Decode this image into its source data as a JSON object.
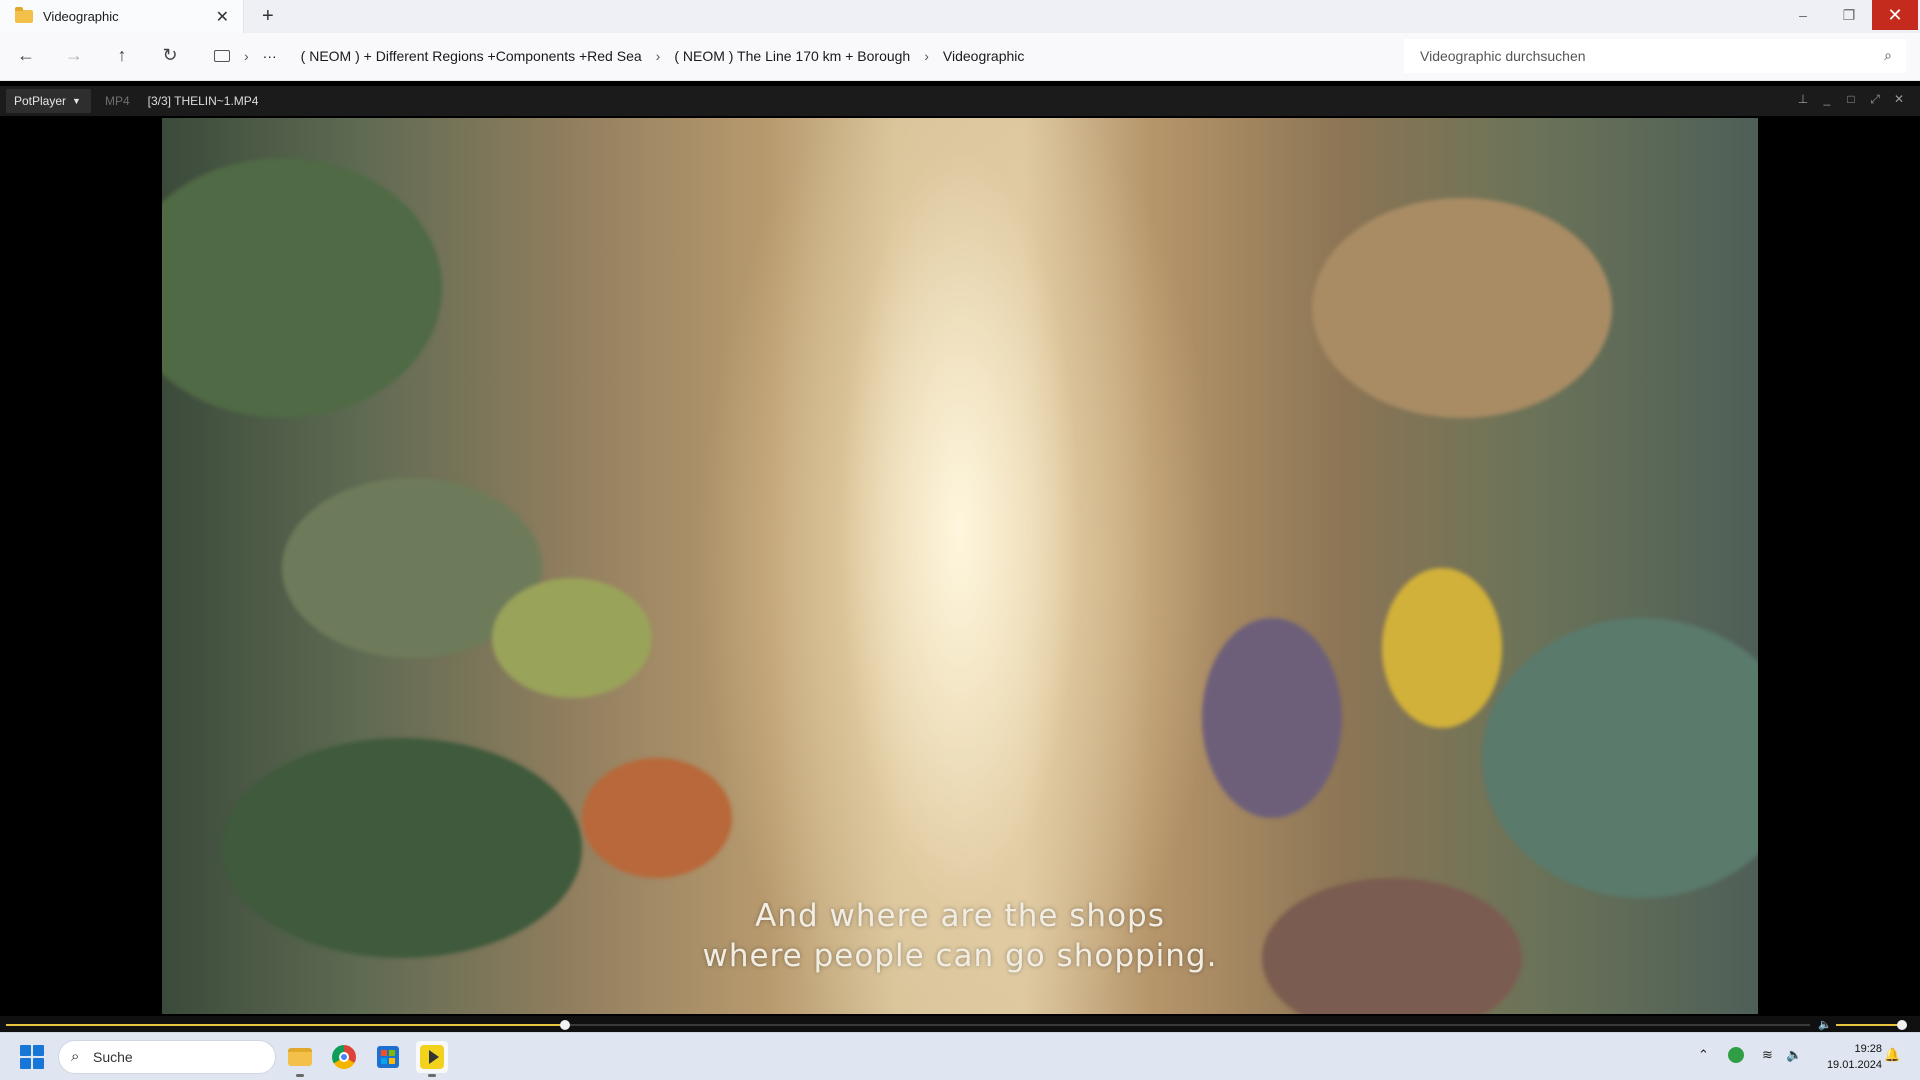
{
  "explorer": {
    "tab_title": "Videographic",
    "new_tab": "+",
    "window_controls": {
      "minimize": "–",
      "restore": "❐",
      "close": "✕"
    },
    "nav": {
      "back": "←",
      "forward": "→",
      "up": "↑",
      "refresh": "↻"
    },
    "breadcrumb": {
      "more": "···",
      "items": [
        "( NEOM ) + Different Regions +Components +Red Sea",
        "( NEOM ) The Line 170 km + Borough",
        "Videographic"
      ]
    },
    "search_placeholder": "Videographic durchsuchen"
  },
  "player": {
    "app_button": "PotPlayer",
    "format": "MP4",
    "file_title": "[3/3] THELIN~1.MP4",
    "subtitle_line1": "And where are the shops",
    "subtitle_line2": "where people can go shopping.",
    "seek_progress": 0.31,
    "volume_level": 1.0,
    "accent_color": "#e7c43c"
  },
  "taskbar": {
    "search_placeholder": "Suche",
    "apps": [
      "file-explorer",
      "chrome",
      "microsoft-store",
      "potplayer"
    ],
    "clock_time": "19:28",
    "clock_date": "19.01.2024"
  }
}
